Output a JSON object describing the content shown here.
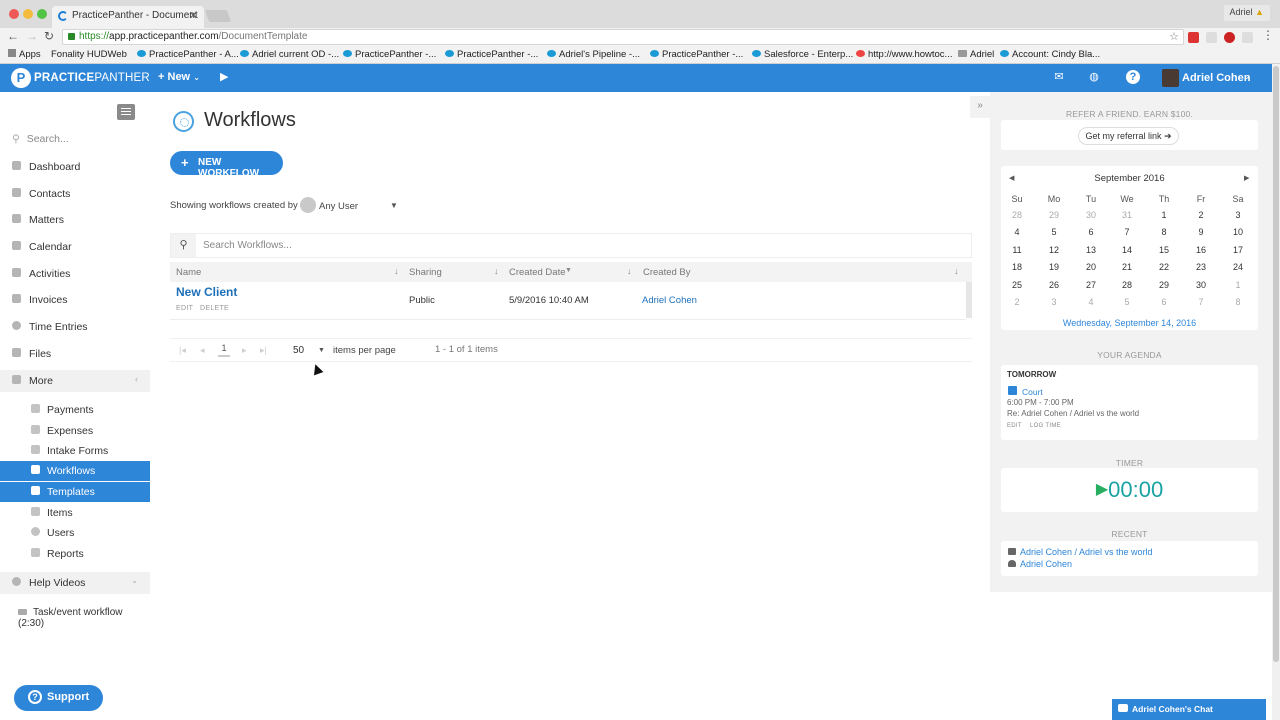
{
  "browser": {
    "tab_title": "PracticePanther - Document",
    "url_scheme": "https://",
    "url_host": "app.practicepanther.com",
    "url_path": "/DocumentTemplate",
    "profile": "Adriel",
    "bookmarks": [
      "Apps",
      "Fonality HUDWeb",
      "PracticePanther - A...",
      "Adriel current OD -...",
      "PracticePanther -...",
      "PracticePanther -...",
      "Adriel's Pipeline -...",
      "PracticePanther -...",
      "Salesforce - Enterp...",
      "http://www.howtoc...",
      "Adriel",
      "Account: Cindy Bla..."
    ]
  },
  "topbar": {
    "logo_bold": "PRACTICE",
    "logo_thin": "PANTHER",
    "new_label": "New",
    "user_name": "Adriel Cohen",
    "brand_color": "#2e86d9"
  },
  "sidebar": {
    "search_placeholder": "Search...",
    "items": [
      {
        "label": "Dashboard",
        "icon": "dashboard-icon"
      },
      {
        "label": "Contacts",
        "icon": "contacts-icon"
      },
      {
        "label": "Matters",
        "icon": "briefcase-icon"
      },
      {
        "label": "Calendar",
        "icon": "calendar-icon"
      },
      {
        "label": "Activities",
        "icon": "list-icon"
      },
      {
        "label": "Invoices",
        "icon": "invoice-icon"
      },
      {
        "label": "Time Entries",
        "icon": "clock-icon"
      },
      {
        "label": "Files",
        "icon": "folder-icon"
      },
      {
        "label": "More",
        "icon": "grid-icon"
      }
    ],
    "sub_items": [
      {
        "label": "Payments",
        "icon": "payment-icon"
      },
      {
        "label": "Expenses",
        "icon": "expense-icon"
      },
      {
        "label": "Intake Forms",
        "icon": "megaphone-icon"
      },
      {
        "label": "Workflows",
        "icon": "workflow-icon"
      },
      {
        "label": "Templates",
        "icon": "template-icon"
      },
      {
        "label": "Items",
        "icon": "tag-icon"
      },
      {
        "label": "Users",
        "icon": "user-icon"
      },
      {
        "label": "Reports",
        "icon": "report-icon"
      }
    ],
    "help_videos": "Help Videos",
    "help_item": "Task/event workflow (2:30)",
    "support_label": "Support"
  },
  "main": {
    "title": "Workflows",
    "new_button": "NEW WORKFLOW",
    "showing_label": "Showing workflows created by",
    "user_filter": "Any User",
    "search_placeholder": "Search Workflows...",
    "columns": [
      "Name",
      "Sharing",
      "Created Date",
      "Created By"
    ],
    "rows": [
      {
        "name": "New Client",
        "edit": "EDIT",
        "delete": "DELETE",
        "sharing": "Public",
        "created_date": "5/9/2016 10:40 AM",
        "created_by": "Adriel Cohen"
      }
    ],
    "page": "1",
    "items_per_page": "50",
    "items_per_page_label": "items per page",
    "count_label": "1 - 1 of 1 items"
  },
  "right": {
    "referral_head": "REFER A FRIEND. EARN $100.",
    "referral_btn": "Get my referral link",
    "calendar": {
      "month": "September 2016",
      "dow": [
        "Su",
        "Mo",
        "Tu",
        "We",
        "Th",
        "Fr",
        "Sa"
      ],
      "weeks": [
        [
          "28",
          "29",
          "30",
          "31",
          "1",
          "2",
          "3"
        ],
        [
          "4",
          "5",
          "6",
          "7",
          "8",
          "9",
          "10"
        ],
        [
          "11",
          "12",
          "13",
          "14",
          "15",
          "16",
          "17"
        ],
        [
          "18",
          "19",
          "20",
          "21",
          "22",
          "23",
          "24"
        ],
        [
          "25",
          "26",
          "27",
          "28",
          "29",
          "30",
          "1"
        ],
        [
          "2",
          "3",
          "4",
          "5",
          "6",
          "7",
          "8"
        ]
      ],
      "footer": "Wednesday, September 14, 2016"
    },
    "agenda": {
      "head": "YOUR AGENDA",
      "day": "TOMORROW",
      "title": "Court",
      "time": "6:00 PM - 7:00 PM",
      "re": "Re: Adriel Cohen / Adriel vs the world",
      "edit": "EDIT",
      "log": "LOG TIME"
    },
    "timer": {
      "head": "TIMER",
      "value": "00:00"
    },
    "recent": {
      "head": "RECENT",
      "items": [
        "Adriel Cohen / Adriel vs the world",
        "Adriel Cohen"
      ]
    },
    "chat_label": "Adriel Cohen's Chat"
  }
}
